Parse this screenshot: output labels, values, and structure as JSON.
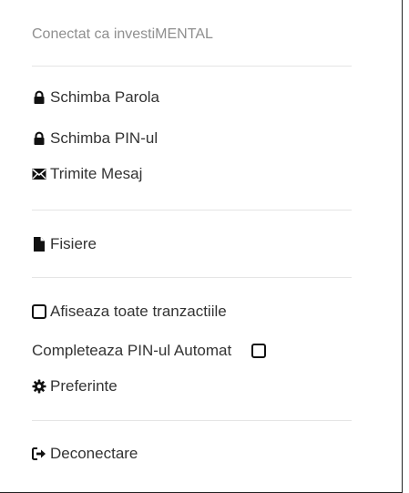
{
  "menu": {
    "connected_label": "Conectat ca investiMENTAL",
    "items": [
      {
        "label": "Schimba Parola",
        "icon": "lock-icon"
      },
      {
        "label": "Schimba PIN-ul",
        "icon": "lock-icon"
      },
      {
        "label": "Trimite Mesaj",
        "icon": "envelope-icon"
      },
      {
        "label": "Fisiere",
        "icon": "file-icon"
      },
      {
        "label": "Afiseaza toate tranzactiile",
        "icon": "checkbox-icon",
        "checked": false
      },
      {
        "label": "Completeaza PIN-ul Automat",
        "icon": "checkbox-icon",
        "checked": false
      },
      {
        "label": "Preferinte",
        "icon": "gear-icon"
      },
      {
        "label": "Deconectare",
        "icon": "sign-out-icon"
      }
    ]
  },
  "colors": {
    "text": "#333333",
    "muted": "#8f8f8f",
    "divider": "#e5e5e5",
    "border": "#222222",
    "icon": "#111111"
  }
}
